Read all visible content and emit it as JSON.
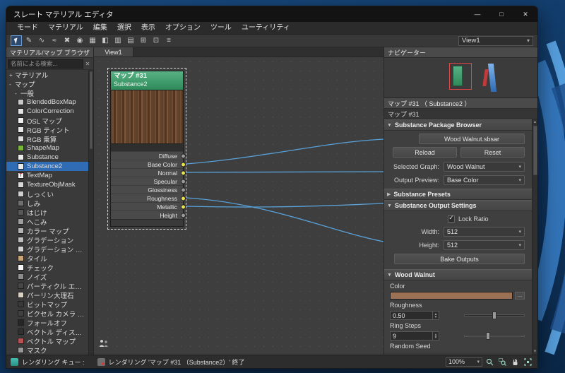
{
  "window": {
    "title": "スレート マテリアル エディタ",
    "minimize_glyph": "—",
    "maximize_glyph": "□",
    "close_glyph": "✕"
  },
  "menubar": {
    "items": [
      "モード",
      "マテリアル",
      "編集",
      "選択",
      "表示",
      "オプション",
      "ツール",
      "ユーティリティ"
    ]
  },
  "toolbar": {
    "icons": [
      "select-tool",
      "pencil-tool",
      "curved-wires-toggle",
      "straight-wires-toggle",
      "delete-selected",
      "material-preview",
      "show-shaded-material",
      "show-end-result",
      "auto-layout-vertical",
      "auto-layout-horizontal",
      "layout-children",
      "zoom-extents-tool",
      "editor-options"
    ],
    "view_selector_value": "View1"
  },
  "browser": {
    "title": "マテリアル/マップ ブラウザ",
    "search_placeholder": "名前による検索...",
    "tree": [
      {
        "expander": "+",
        "label": "マテリアル",
        "indent": 0
      },
      {
        "expander": "-",
        "label": "マップ",
        "indent": 0
      },
      {
        "expander": "-",
        "label": "一般",
        "indent": 1
      }
    ],
    "items": [
      {
        "label": "BlendedBoxMap",
        "icon": "#c9c9c9"
      },
      {
        "label": "ColorCorrection",
        "icon": "#e4e4e4"
      },
      {
        "label": "OSL マップ",
        "icon": "#f0f0f0"
      },
      {
        "label": "RGB ティント",
        "icon": "#e8e8e8"
      },
      {
        "label": "RGB 乗算",
        "icon": "#dedede"
      },
      {
        "label": "ShapeMap",
        "icon": "#79b43c"
      },
      {
        "label": "Substance",
        "icon": "#ececec"
      },
      {
        "label": "Substance2",
        "icon": "#ececec",
        "selected": true
      },
      {
        "label": "TextMap",
        "icon": "#f4f4f4",
        "glyph": "T",
        "glyph_color": "#c03030"
      },
      {
        "label": "TextureObjMask",
        "icon": "#d8d8d8"
      },
      {
        "label": "しっくい",
        "icon": "#cfcfcf"
      },
      {
        "label": "しみ",
        "icon": "#6f6f6f"
      },
      {
        "label": "はじけ",
        "icon": "#585858"
      },
      {
        "label": "へこみ",
        "icon": "#9d9d9d"
      },
      {
        "label": "カラー マップ",
        "icon": "#b5b5b5"
      },
      {
        "label": "グラデーション",
        "icon": "#bfbfbf"
      },
      {
        "label": "グラデーション ランプ",
        "icon": "#d3d3d3"
      },
      {
        "label": "タイル",
        "icon": "#c8a478"
      },
      {
        "label": "チェック",
        "icon": "#f8f8f8"
      },
      {
        "label": "ノイズ",
        "icon": "#8d8d8d"
      },
      {
        "label": "パーティクル エージ",
        "icon": "#474747"
      },
      {
        "label": "パーリン大理石",
        "icon": "#d9d2c4"
      },
      {
        "label": "ビットマップ",
        "icon": "#383838"
      },
      {
        "label": "ピクセル カメラ マップ",
        "icon": "#404040"
      },
      {
        "label": "フォールオフ",
        "icon": "#262626"
      },
      {
        "label": "ベクトル ディスプレイ...",
        "icon": "#303030"
      },
      {
        "label": "ベクトル マップ",
        "icon": "#b85353"
      },
      {
        "label": "マスク",
        "icon": "#979797"
      }
    ]
  },
  "canvas": {
    "tab": "View1",
    "node": {
      "title": "マップ #31",
      "subtitle": "Substance2",
      "slots": [
        {
          "label": "Diffuse",
          "connected": false
        },
        {
          "label": "Base Color",
          "connected": true
        },
        {
          "label": "Normal",
          "connected": true
        },
        {
          "label": "Specular",
          "connected": false
        },
        {
          "label": "Glossiness",
          "connected": false
        },
        {
          "label": "Roughness",
          "connected": true
        },
        {
          "label": "Metallic",
          "connected": true
        },
        {
          "label": "Height",
          "connected": false
        }
      ]
    }
  },
  "navigator": {
    "title": "ナビゲーター"
  },
  "params": {
    "panel_title": "マップ #31 （ Substance2 ）",
    "map_name": "マップ #31",
    "package_browser": {
      "title": "Substance Package Browser",
      "file_button": "Wood Walnut.sbsar",
      "reload_button": "Reload",
      "reset_button": "Reset",
      "selected_graph_label": "Selected Graph:",
      "selected_graph_value": "Wood Walnut",
      "output_preview_label": "Output Preview:",
      "output_preview_value": "Base Color"
    },
    "presets": {
      "title": "Substance Presets"
    },
    "output_settings": {
      "title": "Substance Output Settings",
      "lock_ratio_label": "Lock Ratio",
      "lock_ratio_checked": true,
      "width_label": "Width:",
      "width_value": "512",
      "height_label": "Height:",
      "height_value": "512",
      "bake_button": "Bake Outputs"
    },
    "wood_walnut": {
      "title": "Wood Walnut",
      "color_label": "Color",
      "color_value": "#9b7156",
      "roughness_label": "Roughness",
      "roughness_value": "0.50",
      "ring_steps_label": "Ring Steps",
      "ring_steps_value": "9",
      "random_seed_label": "Random Seed"
    }
  },
  "statusbar": {
    "queue_label": "レンダリング キュー :",
    "message": "レンダリング 'マップ #31 （Substance2）' 終了",
    "zoom_value": "100%"
  },
  "colors": {
    "selection_blue": "#2f6cb4",
    "node_header_green": "#3f9e6e",
    "wire_blue": "#5aa7e0",
    "connected_slot_yellow": "#e8e34a"
  }
}
